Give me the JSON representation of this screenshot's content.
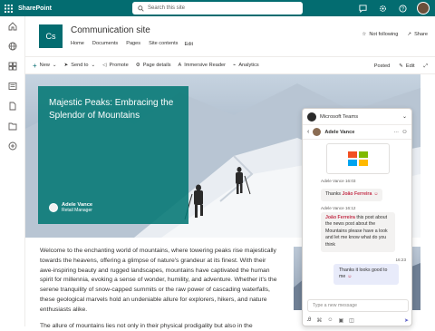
{
  "app": {
    "name": "SharePoint",
    "brand_color": "#036C70"
  },
  "search": {
    "placeholder": "Search this site"
  },
  "topbar": {
    "icons": [
      "chat-icon",
      "gear-icon",
      "help-icon",
      "avatar"
    ]
  },
  "rail": {
    "icons": [
      "home-icon",
      "globe-icon",
      "sites-icon",
      "news-icon",
      "document-icon",
      "files-icon",
      "add-icon"
    ]
  },
  "site": {
    "logo": "Cs",
    "title": "Communication site",
    "nav": [
      "Home",
      "Documents",
      "Pages",
      "Site contents",
      "Edit"
    ],
    "follow": "Not following",
    "share": "Share"
  },
  "commandbar": {
    "left": [
      "New",
      "Send to",
      "Promote",
      "Page details",
      "Immersive Reader",
      "Analytics"
    ],
    "right": [
      "Posted",
      "Edit"
    ]
  },
  "hero": {
    "title": "Majestic Peaks: Embracing the Splendor of Mountains",
    "author_name": "Adele Vance",
    "author_role": "Retail Manager"
  },
  "article": {
    "p1": "Welcome to the enchanting world of mountains, where towering peaks rise majestically towards the heavens, offering a glimpse of nature's grandeur at its finest. With their awe-inspiring beauty and rugged landscapes, mountains have captivated the human spirit for millennia, evoking a sense of wonder, humility, and adventure. Whether it's the serene tranquility of snow-capped summits or the raw power of cascading waterfalls, these geological marvels hold an undeniable allure for explorers, hikers, and nature enthusiasts alike.",
    "p2": "The allure of mountains lies not only in their physical prodigality but also in the"
  },
  "teams": {
    "title": "Microsoft Teams",
    "chat_with": "Adele Vance",
    "messages": [
      {
        "meta": "Adele Vance  16:03",
        "text_pre": "Thanks ",
        "mention": "João Ferreira",
        "text_post": ""
      },
      {
        "meta": "Adele Vance  16:12",
        "text_pre": "",
        "mention": "João Ferreira",
        "text_post": " this post about the news post about the Mountains please have a look and let me know what do you think"
      }
    ],
    "my_meta": "16:23",
    "my_message": "Thanks it looks good to me",
    "compose_placeholder": "Type a new message"
  }
}
